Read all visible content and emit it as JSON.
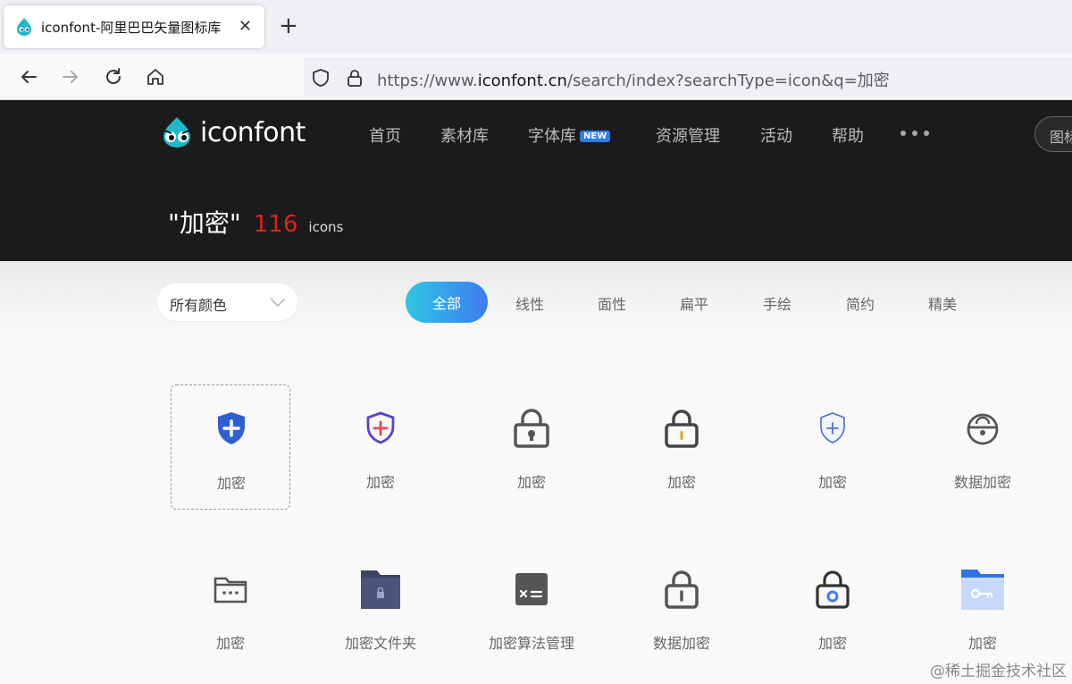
{
  "browser": {
    "tab_title": "iconfont-阿里巴巴矢量图标库",
    "close_glyph": "✕",
    "new_tab_glyph": "+",
    "url_prefix": "https://www.",
    "url_host": "iconfont.cn",
    "url_path": "/search/index?searchType=icon&q=加密"
  },
  "site": {
    "logo_text": "iconfont",
    "nav": [
      "首页",
      "素材库",
      "字体库",
      "资源管理",
      "活动",
      "帮助"
    ],
    "new_badge": "NEW",
    "search_placeholder": "图标",
    "query_display": "\"加密\"",
    "result_count": "116",
    "result_unit": "icons"
  },
  "filters": {
    "color_select": "所有颜色",
    "styles": [
      "全部",
      "线性",
      "面性",
      "扁平",
      "手绘",
      "简约",
      "精美"
    ],
    "active_style": "全部"
  },
  "icons": [
    {
      "label": "加密",
      "icon": "shield-plus-blue-icon"
    },
    {
      "label": "加密",
      "icon": "shield-plus-outline-icon"
    },
    {
      "label": "加密",
      "icon": "padlock-keyhole-icon"
    },
    {
      "label": "加密",
      "icon": "padlock-orange-icon"
    },
    {
      "label": "加密",
      "icon": "shield-plus-thin-icon"
    },
    {
      "label": "数据加密",
      "icon": "round-lock-icon"
    },
    {
      "label": "加密",
      "icon": "folder-password-icon"
    },
    {
      "label": "加密文件夹",
      "icon": "dark-folder-lock-icon"
    },
    {
      "label": "加密算法管理",
      "icon": "algorithm-box-icon"
    },
    {
      "label": "数据加密",
      "icon": "padlock-outline-icon"
    },
    {
      "label": "加密",
      "icon": "padlock-blue-dot-icon"
    },
    {
      "label": "加密",
      "icon": "blue-folder-key-icon"
    }
  ],
  "colors": {
    "accent_start": "#2fc6e4",
    "accent_end": "#3d7cf0",
    "count_red": "#e0201c",
    "header_bg": "#1b1b1d"
  },
  "watermark": "@稀土掘金技术社区"
}
